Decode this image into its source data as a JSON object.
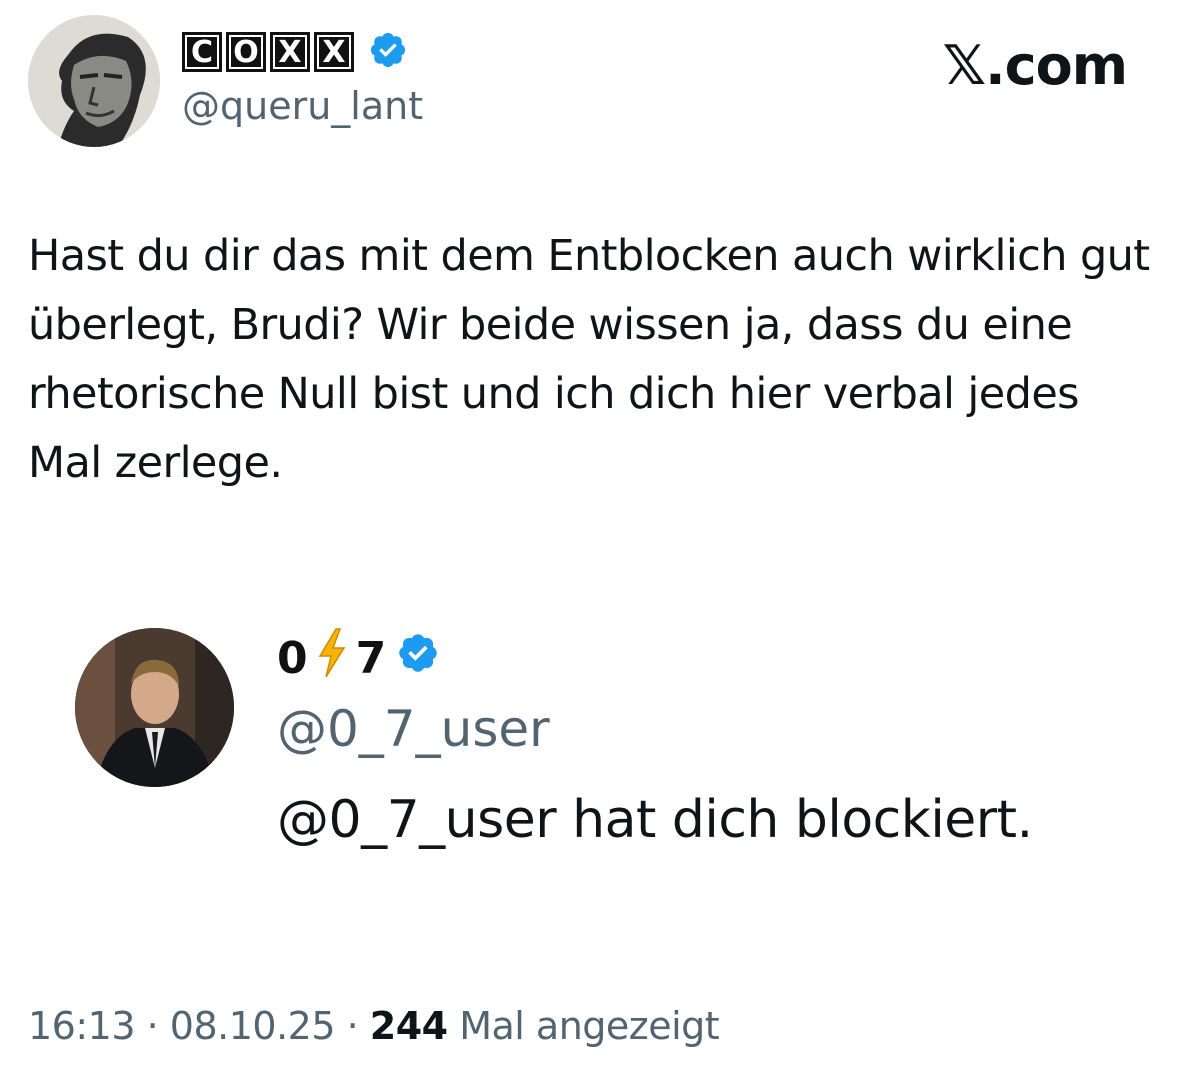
{
  "author": {
    "display_name_letters": [
      "C",
      "O",
      "X",
      "X"
    ],
    "handle": "@queru_lant",
    "verified": true
  },
  "brand": {
    "watermark": "𝕏.com"
  },
  "tweet": {
    "text": "Hast du dir das mit dem Entblocken auch wirklich gut überlegt, Brudi? Wir beide wissen ja, dass du eine rhetorische Null bist und ich dich hier verbal jedes Mal zerlege."
  },
  "quoted": {
    "name_left": "0",
    "name_icon": "lightning-icon",
    "name_right": "7",
    "verified": true,
    "handle": "@0_7_user",
    "status": "@0_7_user hat dich blockiert."
  },
  "meta": {
    "time": "16:13",
    "separator": "·",
    "date": "08.10.25",
    "views_count": "244",
    "views_label": "Mal angezeigt"
  },
  "colors": {
    "verified_blue": "#1d9bf0",
    "secondary_text": "#536471",
    "primary_text": "#0f1419",
    "bolt": "#f5b400"
  }
}
